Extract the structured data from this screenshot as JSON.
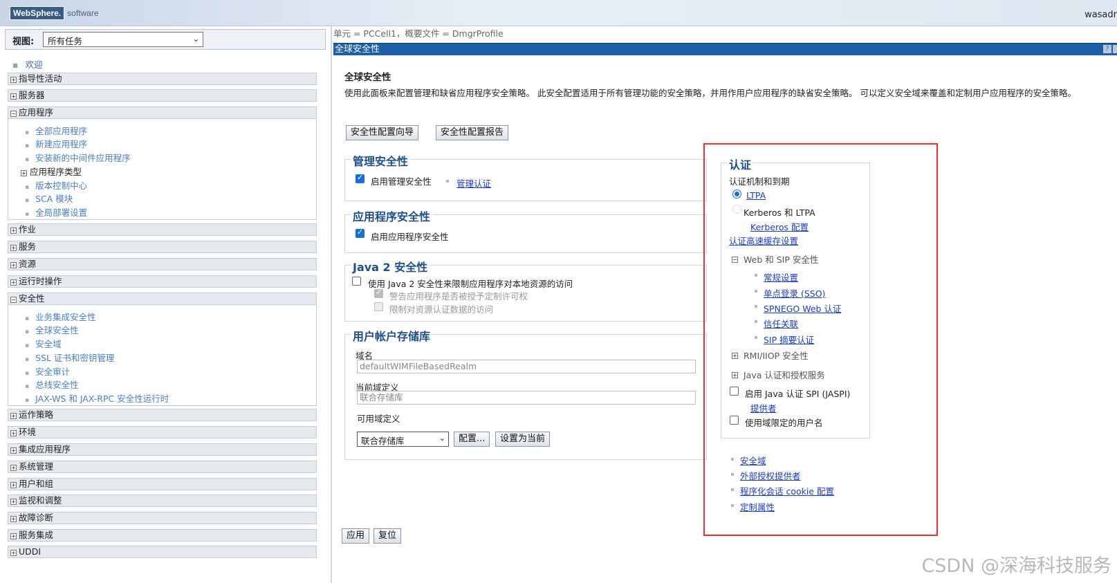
{
  "header": {
    "brand": "WebSphere.",
    "brand_suffix": "software",
    "user": "wasadr"
  },
  "sidebar": {
    "view_label": "视图:",
    "view_value": "所有任务",
    "welcome": "欢迎",
    "sections": {
      "s1": "指导性活动",
      "s2": "服务器",
      "s3": "应用程序",
      "s4": "作业",
      "s5": "服务",
      "s6": "资源",
      "s7": "运行时操作",
      "s8": "安全性",
      "s9": "运作策略",
      "s10": "环境",
      "s11": "集成应用程序",
      "s12": "系统管理",
      "s13": "用户和组",
      "s14": "监视和调整",
      "s15": "故障诊断",
      "s16": "服务集成",
      "s17": "UDDI"
    },
    "app_items": {
      "a1": "全部应用程序",
      "a2": "新建应用程序",
      "a3": "安装新的中间件应用程序",
      "a4": "应用程序类型",
      "a5": "版本控制中心",
      "a6": "SCA 模块",
      "a7": "全局部署设置"
    },
    "sec_items": {
      "b1": "业务集成安全性",
      "b2": "全球安全性",
      "b3": "安全域",
      "b4": "SSL 证书和密钥管理",
      "b5": "安全审计",
      "b6": "总线安全性",
      "b7": "JAX-WS 和 JAX-RPC 安全性运行时"
    }
  },
  "main": {
    "breadcrumb": "单元 = PCCell1，概要文件 = DmgrProfile",
    "panel_title": "全球安全性",
    "page_title": "全球安全性",
    "description": "使用此面板来配置管理和缺省应用程序安全策略。 此安全配置适用于所有管理功能的安全策略，并用作用户应用程序的缺省安全策略。 可以定义安全域来覆盖和定制用户应用程序的安全策略。",
    "btn_wizard": "安全性配置向导",
    "btn_report": "安全性配置报告",
    "admin": {
      "legend": "管理安全性",
      "enable": "启用管理安全性",
      "link": "管理认证"
    },
    "app": {
      "legend": "应用程序安全性",
      "enable": "启用应用程序安全性"
    },
    "java2": {
      "legend": "Java 2 安全性",
      "use": "使用 Java 2 安全性来限制应用程序对本地资源的访问",
      "warn": "警告应用程序是否被授予定制许可权",
      "restrict": "限制对资源认证数据的访问"
    },
    "registry": {
      "legend": "用户帐户存储库",
      "realm_label": "域名",
      "realm_value": "defaultWIMFileBasedRealm",
      "current_label": "当前域定义",
      "current_value": "联合存储库",
      "available_label": "可用域定义",
      "select_value": "联合存储库",
      "btn_configure": "配置...",
      "btn_set_current": "设置为当前"
    },
    "auth": {
      "legend": "认证",
      "mech": "认证机制和到期",
      "ltpa": "LTPA",
      "kerberos": "Kerberos 和 LTPA",
      "kerberos_config": "Kerberos 配置",
      "cache": "认证高速缓存设置",
      "web_sip": "Web 和 SIP 安全性",
      "general": "常规设置",
      "sso": "单点登录 (SSO)",
      "spnego": "SPNEGO Web 认证",
      "trust": "信任关联",
      "sip_digest": "SIP 摘要认证",
      "rmi": "RMI/IIOP 安全性",
      "jaas": "Java 认证和授权服务",
      "jaspi": "启用 Java 认证 SPI (JASPI)",
      "providers": "提供者",
      "realm_user": "使用域限定的用户名"
    },
    "related": {
      "r1": "安全域",
      "r2": "外部授权提供者",
      "r3": "程序化会话 cookie 配置",
      "r4": "定制属性"
    },
    "btn_apply": "应用",
    "btn_reset": "复位"
  },
  "watermark": "CSDN @深海科技服务"
}
